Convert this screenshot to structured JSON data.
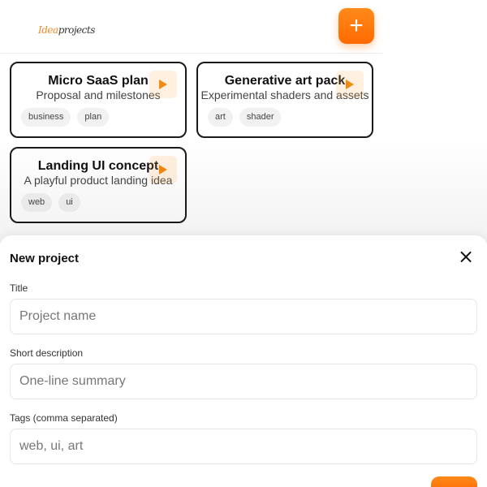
{
  "header": {
    "logo_part1": "Idea",
    "logo_part2": "projects",
    "add_label": "+"
  },
  "projects": [
    {
      "title": "Micro SaaS plan",
      "description": "Proposal and milestones",
      "tags": [
        "business",
        "plan"
      ]
    },
    {
      "title": "Generative art pack",
      "description": "Experimental shaders and assets",
      "tags": [
        "art",
        "shader"
      ]
    },
    {
      "title": "Landing UI concept",
      "description": "A playful product landing idea",
      "tags": [
        "web",
        "ui"
      ]
    }
  ],
  "modal": {
    "title": "New project",
    "close_icon": "×",
    "fields": [
      {
        "label": "Title",
        "placeholder": "Project name",
        "value": ""
      },
      {
        "label": "Short description",
        "placeholder": "One-line summary",
        "value": ""
      },
      {
        "label": "Tags (comma separated)",
        "placeholder": "web, ui, art",
        "value": ""
      }
    ]
  },
  "colors": {
    "accent": "#ff7a0a",
    "card_border": "#1a1a1a"
  },
  "icons": {
    "add": "plus-icon",
    "play": "play-icon",
    "close": "close-icon"
  }
}
